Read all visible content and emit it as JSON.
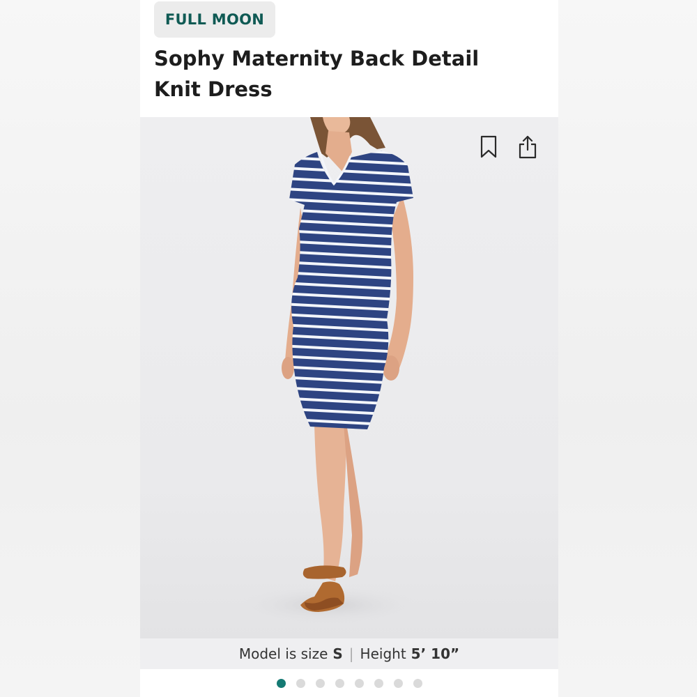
{
  "brand": {
    "label": "FULL MOON"
  },
  "product": {
    "title": "Sophy Maternity Back Detail Knit Dress"
  },
  "model_info": {
    "size_label": "Model is size",
    "size_value": "S",
    "height_label": "Height",
    "height_value": "5’ 10”"
  },
  "carousel": {
    "total": 8,
    "active_index": 0
  },
  "icons": {
    "bookmark": "bookmark-icon",
    "share": "share-icon"
  },
  "colors": {
    "brand_text": "#0f5a54",
    "dot_active": "#157a73",
    "dot_inactive": "#dadada",
    "dress_navy": "#2e4482"
  }
}
